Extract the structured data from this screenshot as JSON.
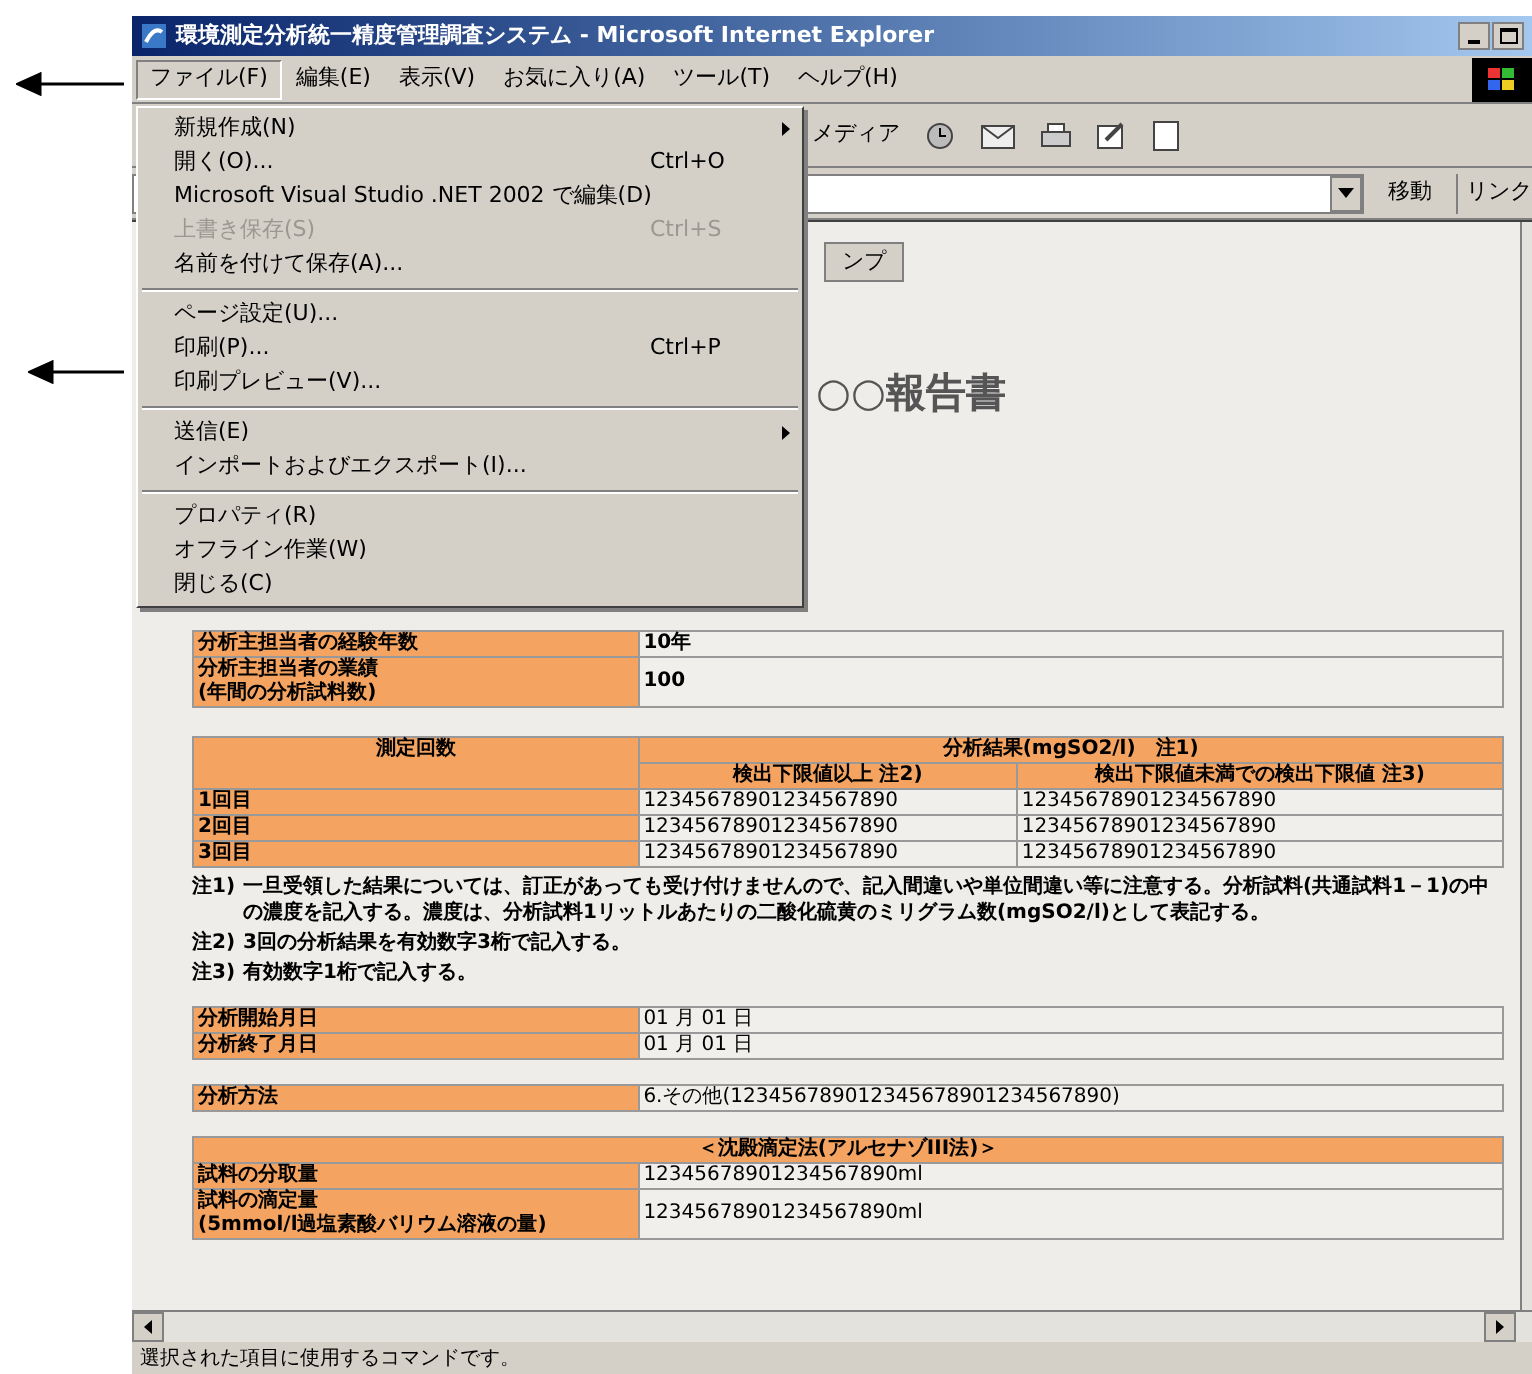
{
  "window": {
    "title": "環境測定分析統一精度管理調査システム - Microsoft Internet Explorer"
  },
  "menu_bar": [
    {
      "label": "ファイル(F)",
      "selected": true
    },
    {
      "label": "編集(E)",
      "selected": false
    },
    {
      "label": "表示(V)",
      "selected": false
    },
    {
      "label": "お気に入り(A)",
      "selected": false
    },
    {
      "label": "ツール(T)",
      "selected": false
    },
    {
      "label": "ヘルプ(H)",
      "selected": false
    }
  ],
  "file_menu": {
    "groups": [
      [
        {
          "label": "新規作成(N)",
          "submenu": true,
          "disabled": false
        },
        {
          "label": "開く(O)...",
          "shortcut": "Ctrl+O",
          "submenu": false,
          "disabled": false
        },
        {
          "label": "Microsoft Visual Studio .NET 2002 で編集(D)",
          "submenu": false,
          "disabled": false
        },
        {
          "label": "上書き保存(S)",
          "shortcut": "Ctrl+S",
          "submenu": false,
          "disabled": true
        },
        {
          "label": "名前を付けて保存(A)...",
          "submenu": false,
          "disabled": false
        }
      ],
      [
        {
          "label": "ページ設定(U)...",
          "submenu": false,
          "disabled": false
        },
        {
          "label": "印刷(P)...",
          "shortcut": "Ctrl+P",
          "submenu": false,
          "disabled": false
        },
        {
          "label": "印刷プレビュー(V)...",
          "submenu": false,
          "disabled": false
        }
      ],
      [
        {
          "label": "送信(E)",
          "submenu": true,
          "disabled": false
        },
        {
          "label": "インポートおよびエクスポート(I)...",
          "submenu": false,
          "disabled": false
        }
      ],
      [
        {
          "label": "プロパティ(R)",
          "submenu": false,
          "disabled": false
        },
        {
          "label": "オフライン作業(W)",
          "submenu": false,
          "disabled": false
        },
        {
          "label": "閉じる(C)",
          "submenu": false,
          "disabled": false
        }
      ]
    ]
  },
  "toolbar": {
    "media_label": "メディア"
  },
  "address_bar": {
    "go_label": "移動",
    "links_label": "リンク"
  },
  "page": {
    "button_label": "ンプ",
    "heading": "○○報告書",
    "staff_table": [
      {
        "label": "分析主担当者の経験年数",
        "value": "10年"
      },
      {
        "label": "分析主担当者の業績\n(年間の分析試料数)",
        "value": "100"
      }
    ],
    "results_table": {
      "row_header": "測定回数",
      "group_header": "分析結果(mgSO2/l)　注1)",
      "columns": [
        "検出下限値以上 注2)",
        "検出下限値未満での検出下限値 注3)"
      ],
      "rows": [
        {
          "label": "1回目",
          "values": [
            "12345678901234567890",
            "12345678901234567890"
          ]
        },
        {
          "label": "2回目",
          "values": [
            "12345678901234567890",
            "12345678901234567890"
          ]
        },
        {
          "label": "3回目",
          "values": [
            "12345678901234567890",
            "12345678901234567890"
          ]
        }
      ]
    },
    "notes": [
      {
        "mark": "注1)",
        "text": "一旦受領した結果については、訂正があっても受け付けませんので、記入間違いや単位間違い等に注意する。分析試料(共通試料1－1)の中の濃度を記入する。濃度は、分析試料1リットルあたりの二酸化硫黄のミリグラム数(mgSO2/l)として表記する。"
      },
      {
        "mark": "注2)",
        "text": "3回の分析結果を有効数字3桁で記入する。"
      },
      {
        "mark": "注3)",
        "text": "有効数字1桁で記入する。"
      }
    ],
    "dates_table": [
      {
        "label": "分析開始月日",
        "value": "01 月 01 日"
      },
      {
        "label": "分析終了月日",
        "value": "01 月 01 日"
      }
    ],
    "method_table": [
      {
        "label": "分析方法",
        "value": "6.その他(123456789012345678901234567890)"
      }
    ],
    "titration_table": {
      "header": "＜沈殿滴定法(アルセナゾIII法)＞",
      "rows": [
        {
          "label": "試料の分取量",
          "value": "12345678901234567890ml"
        },
        {
          "label": "試料の滴定量\n(5mmol/l過塩素酸バリウム溶液の量)",
          "value": "12345678901234567890ml"
        }
      ]
    }
  },
  "status_bar": {
    "text": "選択された項目に使用するコマンドです。"
  }
}
